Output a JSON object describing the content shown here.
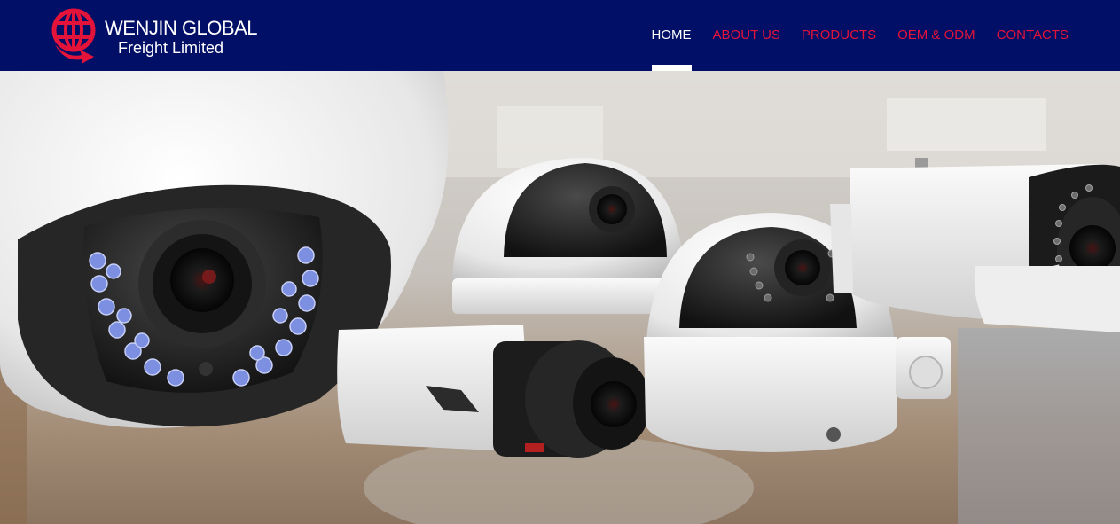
{
  "brand": {
    "name_line1": "WENJIN GLOBAL",
    "name_line2": "Freight Limited",
    "logo_icon": "globe-arrow-icon"
  },
  "nav": {
    "items": [
      {
        "label": "HOME",
        "active": true
      },
      {
        "label": "ABOUT US",
        "active": false
      },
      {
        "label": "PRODUCTS",
        "active": false
      },
      {
        "label": "OEM & ODM",
        "active": false
      },
      {
        "label": "CONTACTS",
        "active": false
      }
    ]
  },
  "hero": {
    "image": "security-cameras-banner"
  },
  "colors": {
    "header_bg": "#020f66",
    "nav_link": "#e4133a",
    "nav_active": "#ffffff",
    "logo_red": "#e4133a"
  }
}
